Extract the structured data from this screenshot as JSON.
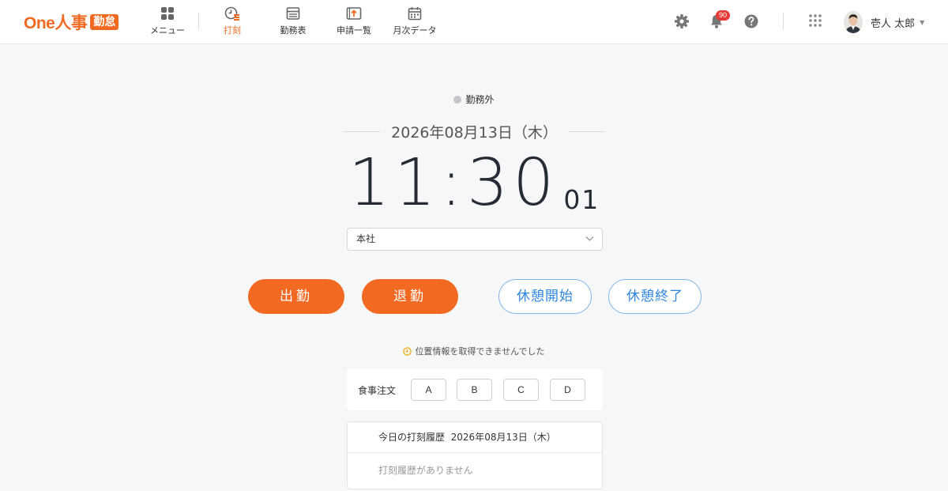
{
  "header": {
    "logo_text": "One人事",
    "logo_badge": "勤怠",
    "nav": [
      {
        "label": "メニュー",
        "icon": "grid-icon",
        "active": false
      },
      {
        "label": "打刻",
        "icon": "clock-icon",
        "active": true
      },
      {
        "label": "勤務表",
        "icon": "table-icon",
        "active": false
      },
      {
        "label": "申請一覧",
        "icon": "request-icon",
        "active": false
      },
      {
        "label": "月次データ",
        "icon": "calendar-icon",
        "active": false
      }
    ],
    "notification_count": "90",
    "user_name": "壱人 太郎"
  },
  "status": {
    "label": "勤務外",
    "dot_color": "#c4c6ca"
  },
  "date": "2026年08月13日（木）",
  "clock": {
    "hhmm": "11:30",
    "seconds": "01"
  },
  "location_select": {
    "value": "本社"
  },
  "actions": {
    "clock_in": "出勤",
    "clock_out": "退勤",
    "break_start": "休憩開始",
    "break_end": "休憩終了"
  },
  "notice": "位置情報を取得できませんでした",
  "meal": {
    "label": "食事注文",
    "options": [
      "A",
      "B",
      "C",
      "D"
    ]
  },
  "history": {
    "title": "今日の打刻履歴",
    "date": "2026年08月13日（木）",
    "empty": "打刻履歴がありません"
  },
  "colors": {
    "accent": "#f26a22",
    "link": "#2e86de",
    "badge": "#e53935"
  }
}
